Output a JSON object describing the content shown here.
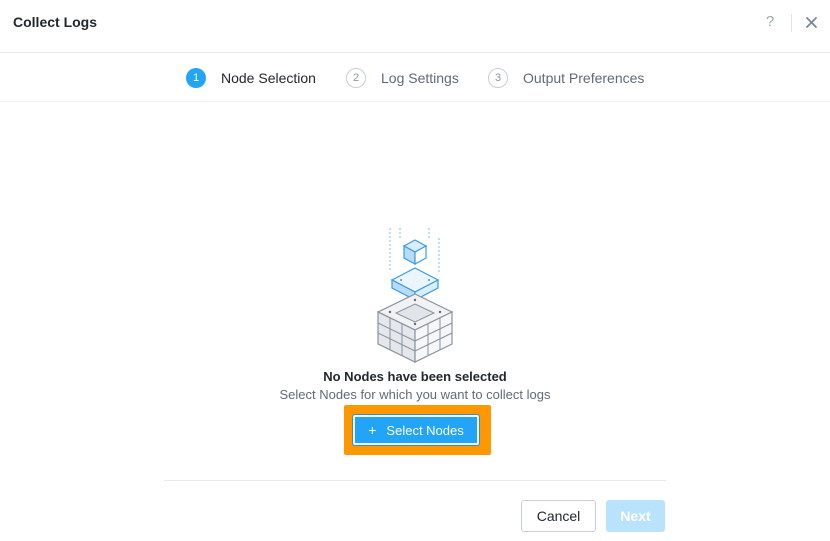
{
  "dialog": {
    "title": "Collect Logs",
    "help_icon": "?",
    "close_icon": "close-icon"
  },
  "steps": [
    {
      "number": "1",
      "label": "Node Selection",
      "state": "active"
    },
    {
      "number": "2",
      "label": "Log Settings",
      "state": "inactive"
    },
    {
      "number": "3",
      "label": "Output Preferences",
      "state": "inactive"
    }
  ],
  "empty_state": {
    "illustration": "nodes-cube-stack-icon",
    "title": "No Nodes have been selected",
    "subtitle": "Select Nodes for which you want to collect logs"
  },
  "actions": {
    "select_nodes_icon": "+",
    "select_nodes_label": "Select Nodes",
    "cancel_label": "Cancel",
    "next_label": "Next"
  },
  "colors": {
    "accent": "#22a5f7",
    "highlight": "#ff9800",
    "next_disabled": "#b9e2fc"
  }
}
